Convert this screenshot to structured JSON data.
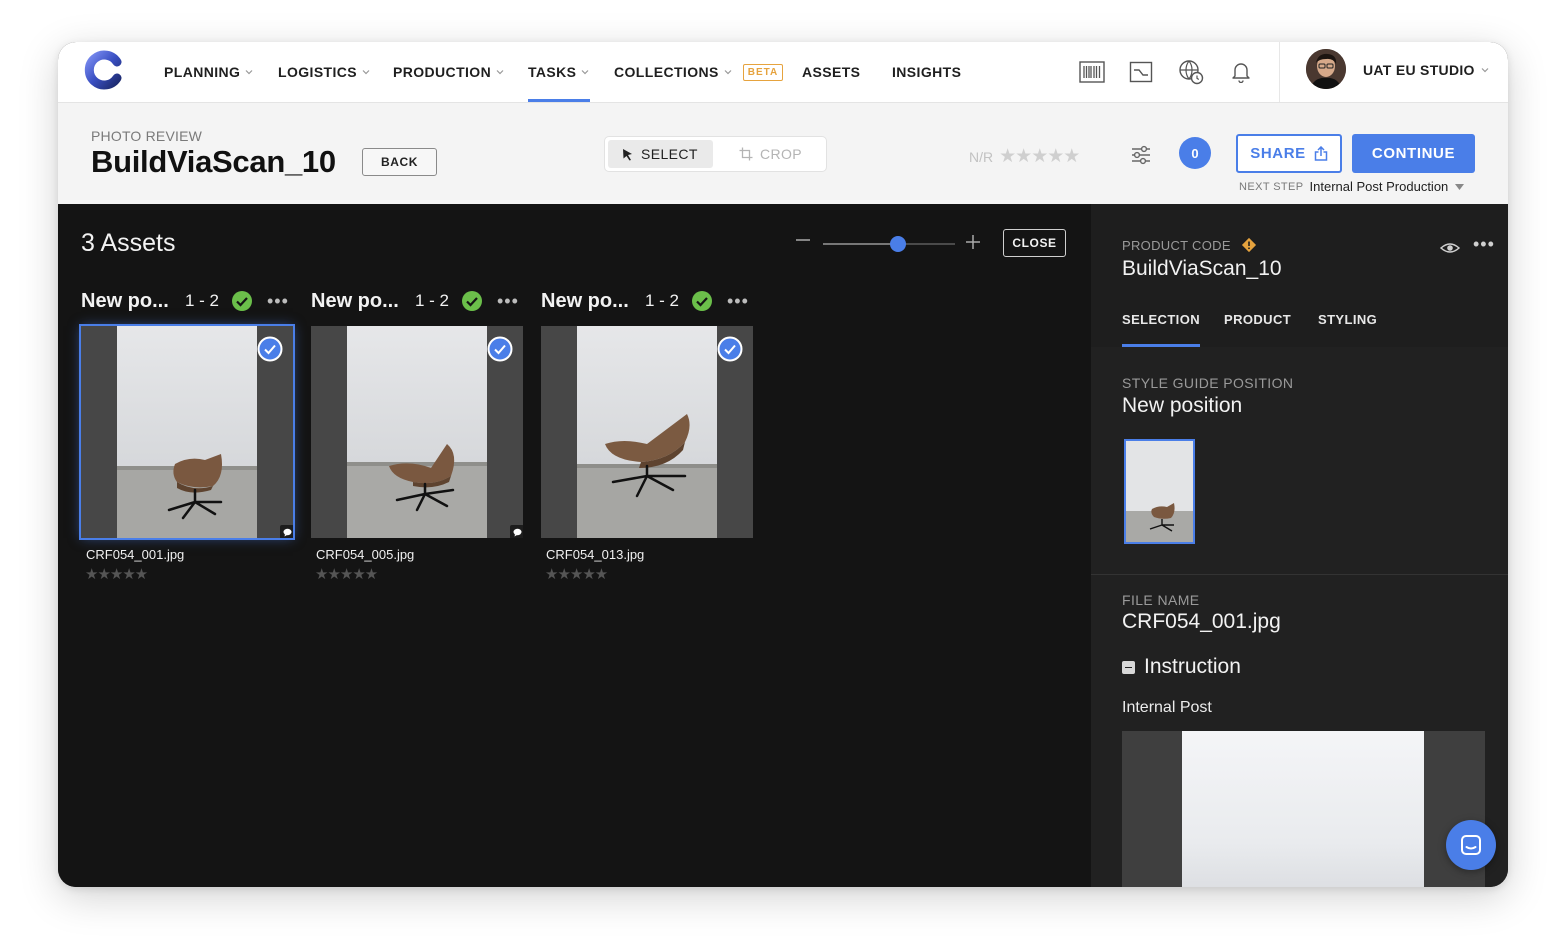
{
  "nav": {
    "items": [
      {
        "label": "PLANNING",
        "dropdown": true
      },
      {
        "label": "LOGISTICS",
        "dropdown": true
      },
      {
        "label": "PRODUCTION",
        "dropdown": true
      },
      {
        "label": "TASKS",
        "dropdown": true,
        "active": true
      },
      {
        "label": "COLLECTIONS",
        "dropdown": true,
        "badge": "BETA"
      },
      {
        "label": "ASSETS",
        "dropdown": false
      },
      {
        "label": "INSIGHTS",
        "dropdown": false
      }
    ],
    "icons": [
      "barcode-icon",
      "trend-chart-icon",
      "globe-clock-icon",
      "bell-icon"
    ],
    "studio": "UAT EU STUDIO"
  },
  "header": {
    "kicker": "PHOTO REVIEW",
    "title": "BuildViaScan_10",
    "back_label": "BACK",
    "tools": {
      "select": "SELECT",
      "crop": "CROP"
    },
    "rating_label": "N/R",
    "rating_stars": "★★★★★",
    "count": "0",
    "share_label": "SHARE",
    "continue_label": "CONTINUE",
    "next_step_label": "NEXT STEP",
    "next_step_value": "Internal Post Production"
  },
  "main": {
    "assets_count": "3 Assets",
    "close_label": "CLOSE",
    "zoom_level": 0.57,
    "groups": [
      {
        "name": "New po...",
        "range": "1 - 2",
        "file": "CRF054_001.jpg",
        "stars": "★★★★★",
        "selected": true,
        "comment": true
      },
      {
        "name": "New po...",
        "range": "1 - 2",
        "file": "CRF054_005.jpg",
        "stars": "★★★★★",
        "selected": false,
        "comment": true
      },
      {
        "name": "New po...",
        "range": "1 - 2",
        "file": "CRF054_013.jpg",
        "stars": "★★★★★",
        "selected": false,
        "comment": false
      }
    ]
  },
  "panel": {
    "product_code_label": "PRODUCT CODE",
    "product_code": "BuildViaScan_10",
    "tabs": [
      {
        "label": "SELECTION",
        "active": true
      },
      {
        "label": "PRODUCT",
        "active": false
      },
      {
        "label": "STYLING",
        "active": false
      }
    ],
    "style_guide_label": "STYLE GUIDE POSITION",
    "style_guide_value": "New position",
    "file_name_label": "FILE NAME",
    "file_name": "CRF054_001.jpg",
    "instruction_label": "Instruction",
    "internal_post_label": "Internal Post"
  },
  "colors": {
    "accent": "#4a7ee8",
    "success": "#6bbf4a",
    "warning": "#e6a33e",
    "beta": "#e6a33e"
  }
}
